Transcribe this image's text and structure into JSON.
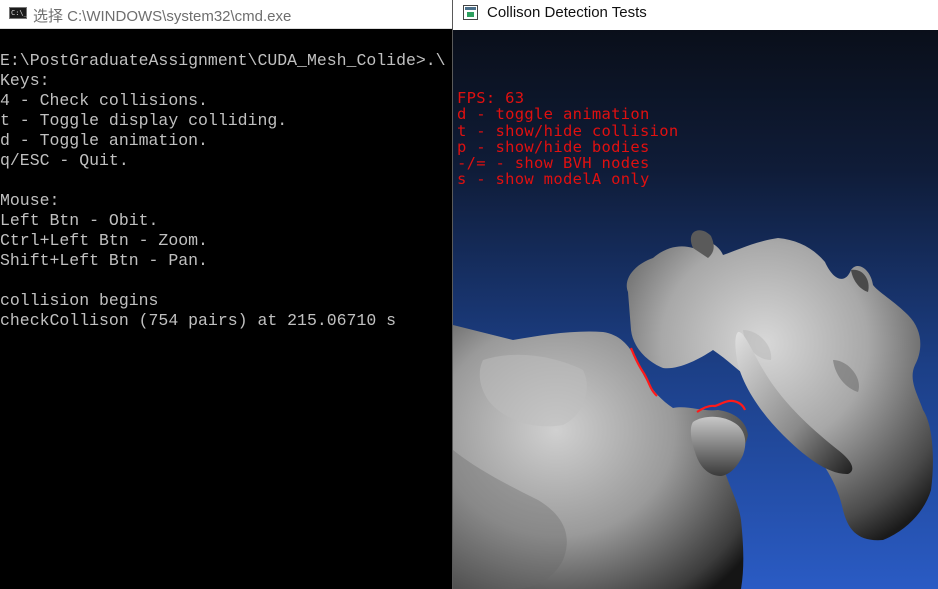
{
  "cmd_window": {
    "title": "选择 C:\\WINDOWS\\system32\\cmd.exe",
    "icon": "cmd-icon",
    "icon_text": "C:\\_",
    "lines": [
      "E:\\PostGraduateAssignment\\CUDA_Mesh_Colide>.\\",
      "Keys:",
      "4 - Check collisions.",
      "t - Toggle display colliding.",
      "d - Toggle animation.",
      "q/ESC - Quit.",
      "",
      "Mouse:",
      "Left Btn - Obit.",
      "Ctrl+Left Btn - Zoom.",
      "Shift+Left Btn - Pan.",
      "",
      "collision begins",
      "checkCollison (754 pairs) at 215.06710 s"
    ]
  },
  "gl_window": {
    "title": "Collison Detection Tests",
    "icon": "opengl-app-icon",
    "hud_color": "#e01010",
    "collision_color": "#ff1a1a",
    "hud_lines": [
      "FPS: 63",
      "d - toggle animation",
      "t - show/hide collision",
      "p - show/hide bodies",
      "-/= - show BVH nodes",
      "s - show modelA only"
    ]
  }
}
